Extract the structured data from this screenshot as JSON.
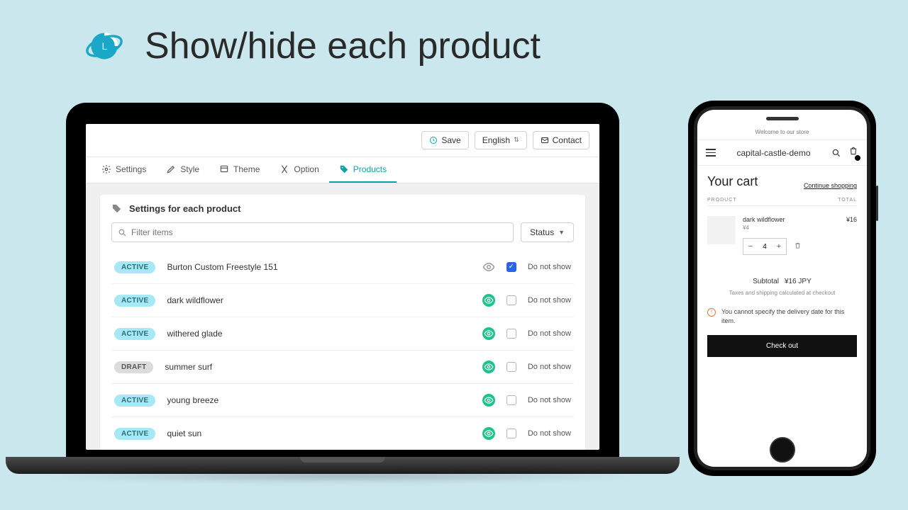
{
  "headline": "Show/hide each product",
  "admin": {
    "save": "Save",
    "language": "English",
    "contact": "Contact",
    "tabs": {
      "settings": "Settings",
      "style": "Style",
      "theme": "Theme",
      "option": "Option",
      "products": "Products"
    },
    "panel_title": "Settings for each product",
    "search_placeholder": "Filter items",
    "status_label": "Status",
    "do_not_show": "Do not show",
    "status_active": "ACTIVE",
    "status_draft": "DRAFT",
    "products": [
      {
        "status": "ACTIVE",
        "name": "Burton Custom Freestyle 151",
        "checked": true,
        "green_eye": false
      },
      {
        "status": "ACTIVE",
        "name": "dark wildflower",
        "checked": false,
        "green_eye": true
      },
      {
        "status": "ACTIVE",
        "name": "withered glade",
        "checked": false,
        "green_eye": true
      },
      {
        "status": "DRAFT",
        "name": "summer surf",
        "checked": false,
        "green_eye": true
      },
      {
        "status": "ACTIVE",
        "name": "young breeze",
        "checked": false,
        "green_eye": true
      },
      {
        "status": "ACTIVE",
        "name": "quiet sun",
        "checked": false,
        "green_eye": true
      }
    ]
  },
  "phone": {
    "welcome": "Welcome to our store",
    "store": "capital-castle-demo",
    "cart_title": "Your cart",
    "continue": "Continue shopping",
    "th_product": "PRODUCT",
    "th_total": "TOTAL",
    "item": {
      "name": "dark wildflower",
      "variant": "¥4",
      "qty": "4",
      "line_total": "¥16"
    },
    "subtotal_label": "Subtotal",
    "subtotal_value": "¥16 JPY",
    "tax_note": "Taxes and shipping calculated at checkout",
    "warning": "You cannot specify the delivery date for this item.",
    "checkout": "Check out"
  }
}
